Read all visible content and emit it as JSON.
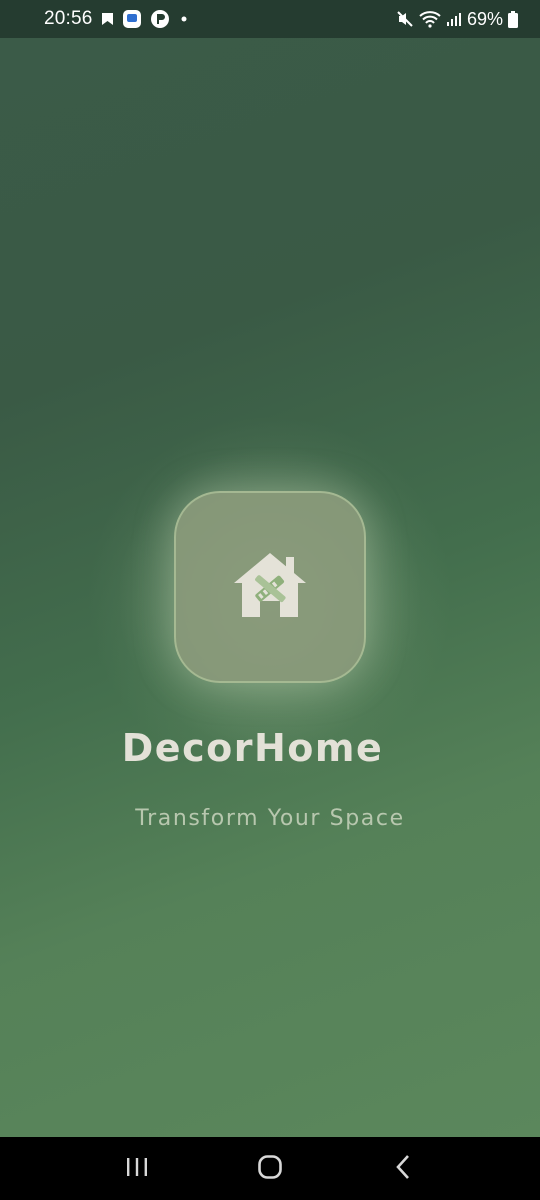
{
  "status_bar": {
    "time": "20:56",
    "battery": "69%",
    "icons_left": [
      "bookmark-icon",
      "app-notification-icon",
      "app-notification-icon",
      "dot-icon"
    ],
    "icons_right": [
      "mute-icon",
      "wifi-icon",
      "signal-icon",
      "battery-icon"
    ]
  },
  "splash": {
    "app_name": "DecorHome",
    "tagline": "Transform Your Space",
    "logo_icon": "house-tools-icon"
  },
  "nav_bar": {
    "buttons": [
      "recent-apps",
      "home",
      "back"
    ]
  },
  "colors": {
    "status_bar_bg": "#253c30",
    "bg_top": "#3b5b48",
    "bg_bottom": "#5b875c",
    "title": "#e3e1d7",
    "tagline": "#b7c7ae",
    "logo_tile": "#8a9a7b"
  }
}
